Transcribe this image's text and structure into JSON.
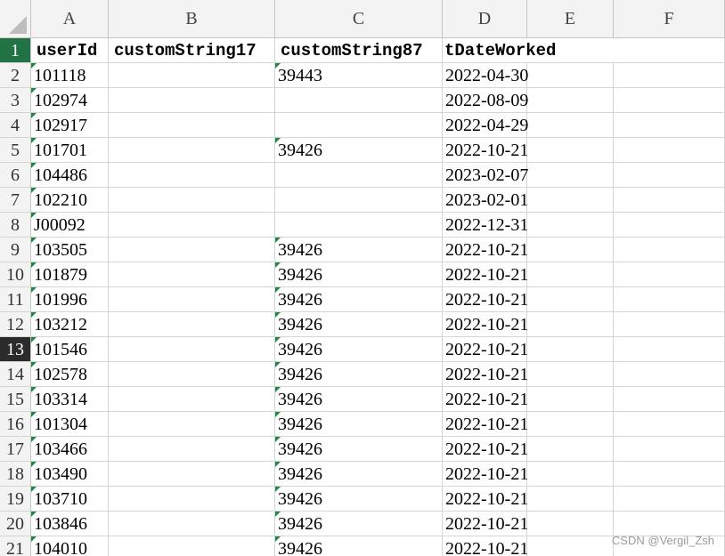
{
  "columns": [
    "A",
    "B",
    "C",
    "D",
    "E",
    "F"
  ],
  "headers": [
    "userId",
    "customString17",
    "customString87",
    "tDateWorked"
  ],
  "rows": [
    {
      "num": "2",
      "a": "101118",
      "b": "",
      "c": "39443",
      "d": "2022-04-30"
    },
    {
      "num": "3",
      "a": "102974",
      "b": "",
      "c": "",
      "d": "2022-08-09"
    },
    {
      "num": "4",
      "a": "102917",
      "b": "",
      "c": "",
      "d": "2022-04-29"
    },
    {
      "num": "5",
      "a": "101701",
      "b": "",
      "c": "39426",
      "d": "2022-10-21"
    },
    {
      "num": "6",
      "a": "104486",
      "b": "",
      "c": "",
      "d": "2023-02-07"
    },
    {
      "num": "7",
      "a": "102210",
      "b": "",
      "c": "",
      "d": "2023-02-01"
    },
    {
      "num": "8",
      "a": "J00092",
      "b": "",
      "c": "",
      "d": "2022-12-31"
    },
    {
      "num": "9",
      "a": "103505",
      "b": "",
      "c": "39426",
      "d": "2022-10-21"
    },
    {
      "num": "10",
      "a": "101879",
      "b": "",
      "c": "39426",
      "d": "2022-10-21"
    },
    {
      "num": "11",
      "a": "101996",
      "b": "",
      "c": "39426",
      "d": "2022-10-21"
    },
    {
      "num": "12",
      "a": "103212",
      "b": "",
      "c": "39426",
      "d": "2022-10-21"
    },
    {
      "num": "13",
      "a": "101546",
      "b": "",
      "c": "39426",
      "d": "2022-10-21"
    },
    {
      "num": "14",
      "a": "102578",
      "b": "",
      "c": "39426",
      "d": "2022-10-21"
    },
    {
      "num": "15",
      "a": "103314",
      "b": "",
      "c": "39426",
      "d": "2022-10-21"
    },
    {
      "num": "16",
      "a": "101304",
      "b": "",
      "c": "39426",
      "d": "2022-10-21"
    },
    {
      "num": "17",
      "a": "103466",
      "b": "",
      "c": "39426",
      "d": "2022-10-21"
    },
    {
      "num": "18",
      "a": "103490",
      "b": "",
      "c": "39426",
      "d": "2022-10-21"
    },
    {
      "num": "19",
      "a": "103710",
      "b": "",
      "c": "39426",
      "d": "2022-10-21"
    },
    {
      "num": "20",
      "a": "103846",
      "b": "",
      "c": "39426",
      "d": "2022-10-21"
    },
    {
      "num": "21",
      "a": "104010",
      "b": "",
      "c": "39426",
      "d": "2022-10-21"
    }
  ],
  "first_row_num": "1",
  "selected_row": "13",
  "watermark": "CSDN @Vergil_Zsh",
  "colors": {
    "accent": "#217346",
    "flag": "#1e8a3c",
    "grid": "#d4d4d4",
    "header_bg": "#f3f3f3"
  }
}
